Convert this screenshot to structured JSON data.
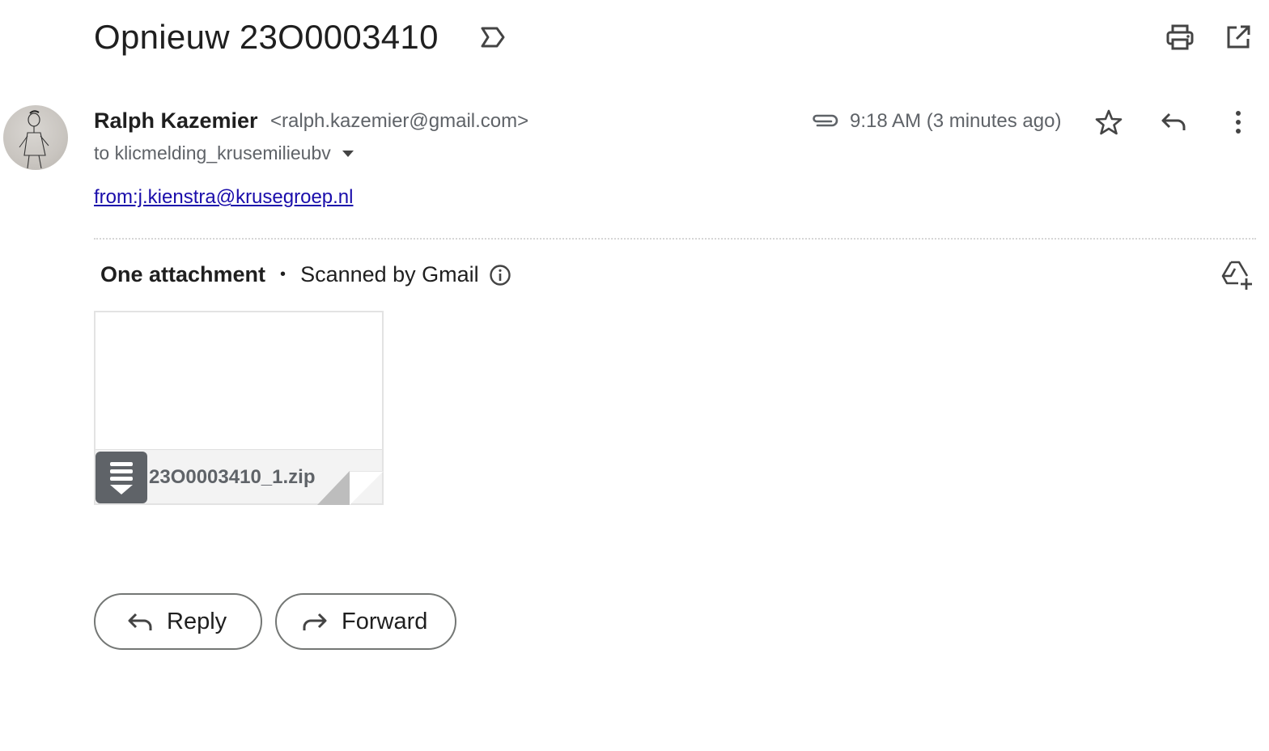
{
  "email": {
    "subject": "Opnieuw 23O0003410",
    "sender": {
      "name": "Ralph Kazemier",
      "email": "<ralph.kazemier@gmail.com>"
    },
    "to_line": "to klicmelding_krusemilieubv",
    "timestamp": "9:18 AM (3 minutes ago)",
    "body_link": "from:j.kienstra@krusegroep.nl"
  },
  "attachments": {
    "count_label": "One attachment",
    "separator": "•",
    "scanned_label": "Scanned by Gmail",
    "files": [
      {
        "name": "23O0003410_1.zip",
        "icon": "zip-file-icon"
      }
    ]
  },
  "actions": {
    "reply_label": "Reply",
    "forward_label": "Forward"
  },
  "icons": {
    "label": "label-outline-icon",
    "print": "print-icon",
    "open_new_window": "open-in-new-icon",
    "attachment": "paperclip-icon",
    "star": "star-icon",
    "reply": "reply-icon",
    "more": "more-vert-icon",
    "info": "info-icon",
    "drive": "add-to-drive-icon"
  },
  "colors": {
    "link": "#1a0dab",
    "text_primary": "#1f1f1f",
    "text_secondary": "#5f6368"
  }
}
